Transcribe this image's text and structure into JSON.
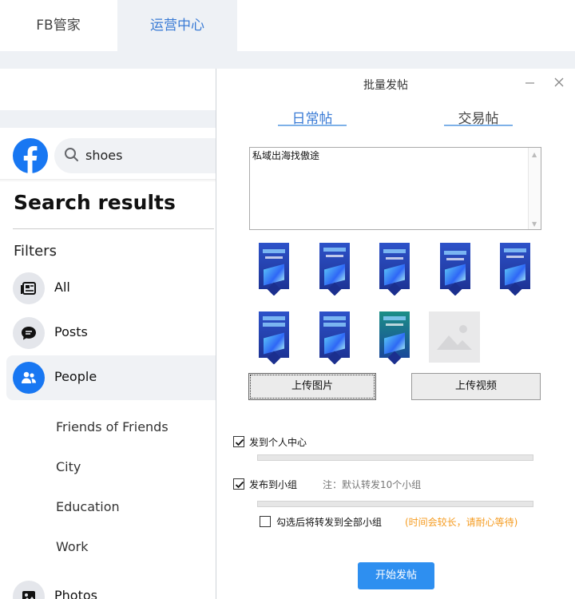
{
  "app_tabs": [
    {
      "label": "FB管家"
    },
    {
      "label": "运营中心"
    }
  ],
  "facebook": {
    "search_value": "shoes",
    "title": "Search results",
    "filters_label": "Filters",
    "filters": [
      {
        "label": "All",
        "icon": "news-feed-icon"
      },
      {
        "label": "Posts",
        "icon": "chat-bubble-icon"
      },
      {
        "label": "People",
        "icon": "people-icon"
      }
    ],
    "sub_filters": [
      "Friends of Friends",
      "City",
      "Education",
      "Work"
    ],
    "photos_label": "Photos",
    "brand_color": "#1877f2"
  },
  "dialog": {
    "title": "批量发帖",
    "tabs": [
      {
        "label": "日常帖"
      },
      {
        "label": "交易帖"
      }
    ],
    "text_value": "私域出海找傲途",
    "upload_image_label": "上传图片",
    "upload_video_label": "上传视频",
    "post_personal": {
      "label": "发到个人中心",
      "checked": true,
      "progress": 0
    },
    "post_groups": {
      "label": "发布到小组",
      "checked": true,
      "note": "注：默认转发10个小组",
      "progress": 0
    },
    "forward_all": {
      "label": "勾选后将转发到全部小组",
      "checked": false,
      "warning": "(时间会较长，请耐心等待)"
    },
    "start_label": "开始发帖",
    "accent_color": "#2e8ff0",
    "warning_color": "#f59b1f"
  }
}
